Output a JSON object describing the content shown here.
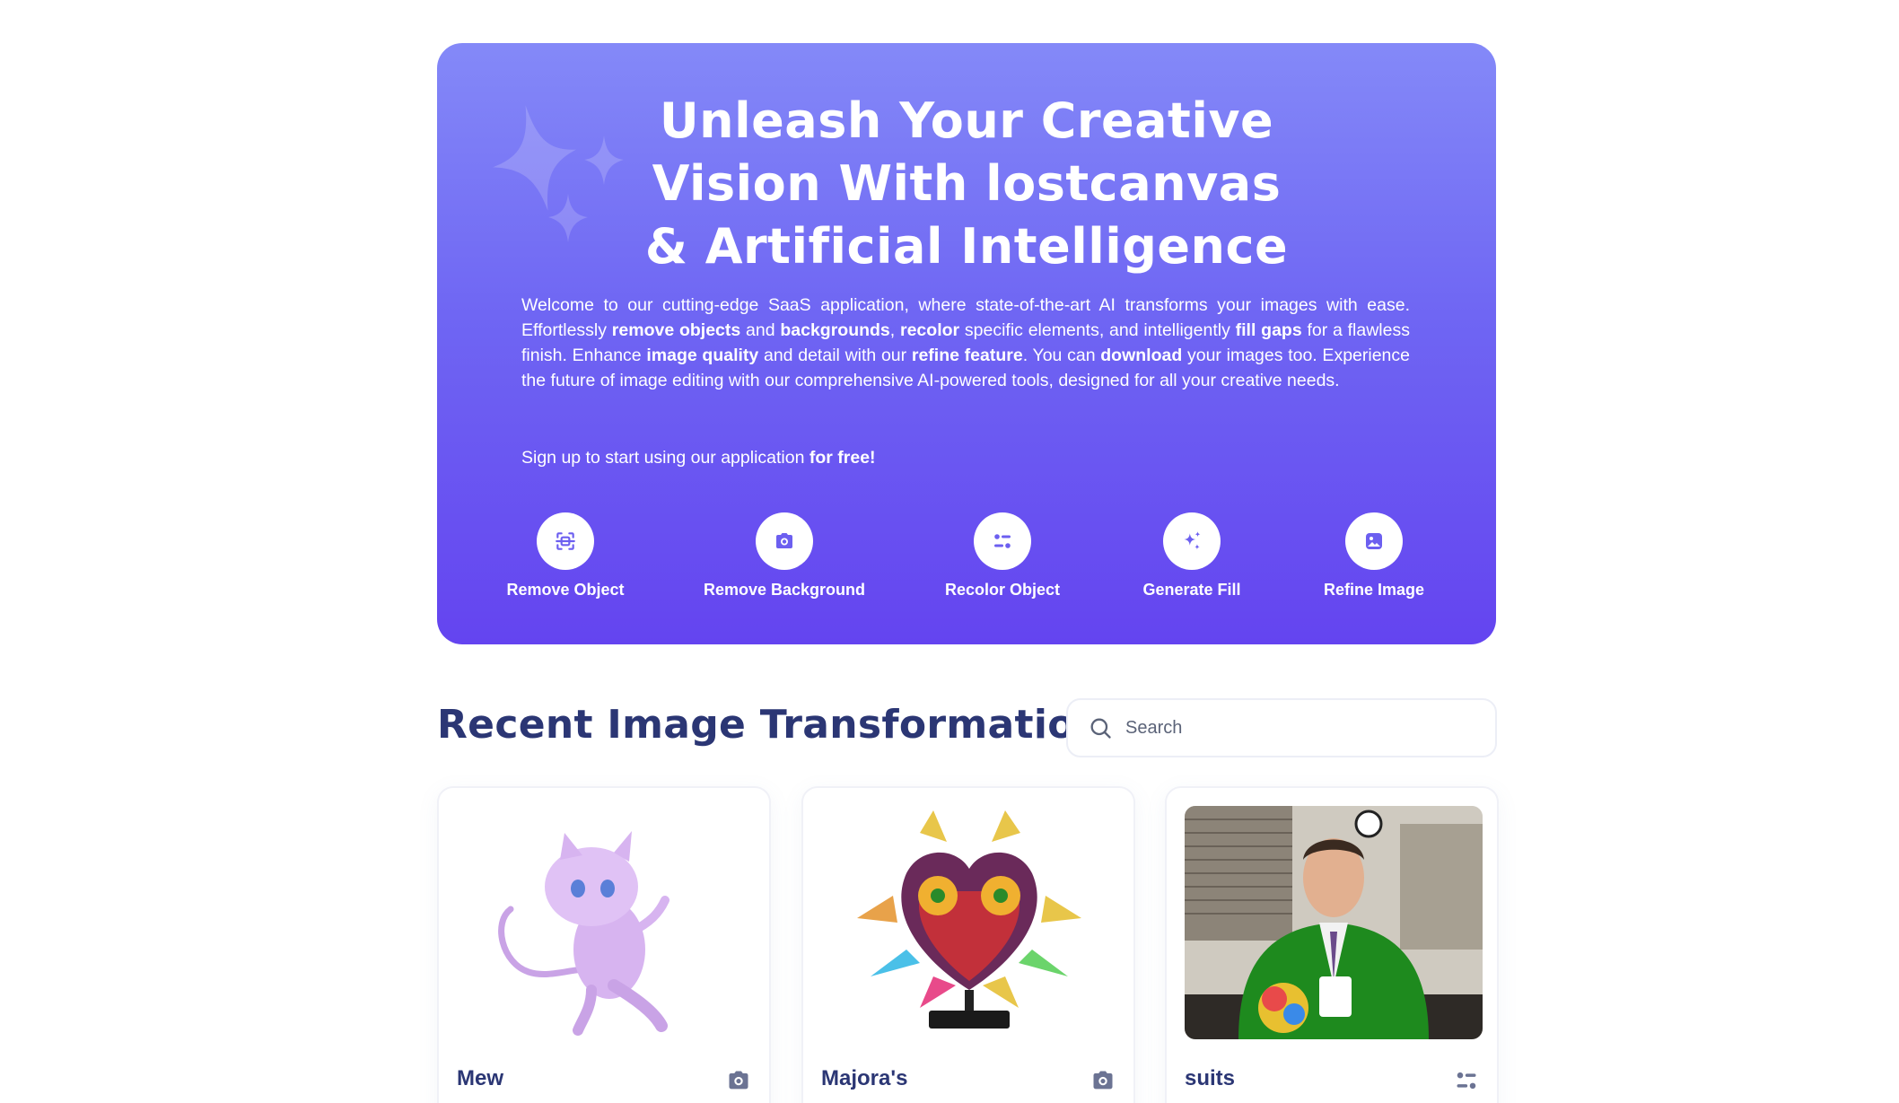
{
  "hero": {
    "title_lines": [
      "Unleash Your Creative",
      "Vision With lostcanvas",
      "& Artificial Intelligence"
    ],
    "body": [
      {
        "t": "Welcome to our cutting-edge SaaS application, where state-of-the-art AI transforms your images with ease. Effortlessly "
      },
      {
        "t": "remove objects",
        "b": true
      },
      {
        "t": " and "
      },
      {
        "t": "backgrounds",
        "b": true
      },
      {
        "t": ", "
      },
      {
        "t": "recolor",
        "b": true
      },
      {
        "t": " specific elements, and intelligently "
      },
      {
        "t": "fill gaps",
        "b": true
      },
      {
        "t": " for a flawless finish. Enhance "
      },
      {
        "t": "image quality",
        "b": true
      },
      {
        "t": " and detail with our "
      },
      {
        "t": "refine feature",
        "b": true
      },
      {
        "t": ". You can "
      },
      {
        "t": "download",
        "b": true
      },
      {
        "t": " your images too. Experience the future of image editing with our comprehensive AI-powered tools, designed for all your creative needs."
      }
    ],
    "cta_prefix": "Sign up to start using our application ",
    "cta_bold": "for free!"
  },
  "tools": [
    {
      "label": "Remove Object",
      "icon": "scan-object-icon"
    },
    {
      "label": "Remove Background",
      "icon": "camera-icon"
    },
    {
      "label": "Recolor Object",
      "icon": "filter-icon"
    },
    {
      "label": "Generate Fill",
      "icon": "stars-icon"
    },
    {
      "label": "Refine Image",
      "icon": "image-icon"
    }
  ],
  "section": {
    "title": "Recent Image Transformations",
    "search_placeholder": "Search"
  },
  "cards": [
    {
      "name": "Mew",
      "type_icon": "camera-icon"
    },
    {
      "name": "Majora's",
      "type_icon": "camera-icon"
    },
    {
      "name": "suits",
      "type_icon": "filter-icon"
    }
  ],
  "colors": {
    "accent": "#624cf5",
    "text_dark": "#2b3674",
    "icon_gray": "#7857ff"
  }
}
